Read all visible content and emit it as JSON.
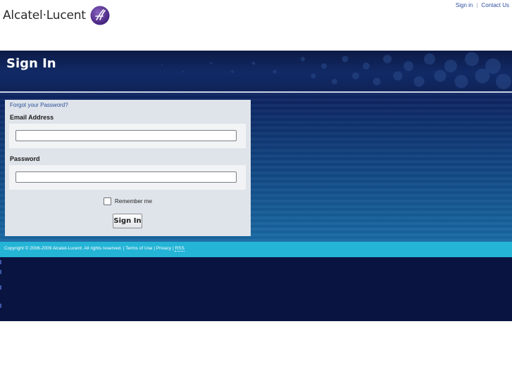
{
  "header": {
    "logo_text": "Alcatel·Lucent",
    "links": {
      "sign_in": "Sign in",
      "separator": "|",
      "contact_us": "Contact Us"
    }
  },
  "banner": {
    "title": "Sign In"
  },
  "form": {
    "forgot_password": "Forgot your Password?",
    "email_label": "Email Address",
    "email_value": "",
    "password_label": "Password",
    "password_value": "",
    "remember_me_label": "Remember me",
    "remember_me_checked": false,
    "submit_label": "Sign In"
  },
  "footer": {
    "copyright": "Copyright © 2006-2009 Alcatel-Lucent. All rights reserved.",
    "sep1": " | ",
    "terms": "Terms of Use",
    "sep2": " | ",
    "privacy": "Privacy",
    "sep3": " | ",
    "rss": "RSS"
  },
  "colors": {
    "banner_bg": "#0d1a46",
    "footer_bg": "#23b4d6",
    "bottom_bg": "#0a1440",
    "link": "#2d4fa0",
    "logo_mark": "#5b2d8e"
  }
}
